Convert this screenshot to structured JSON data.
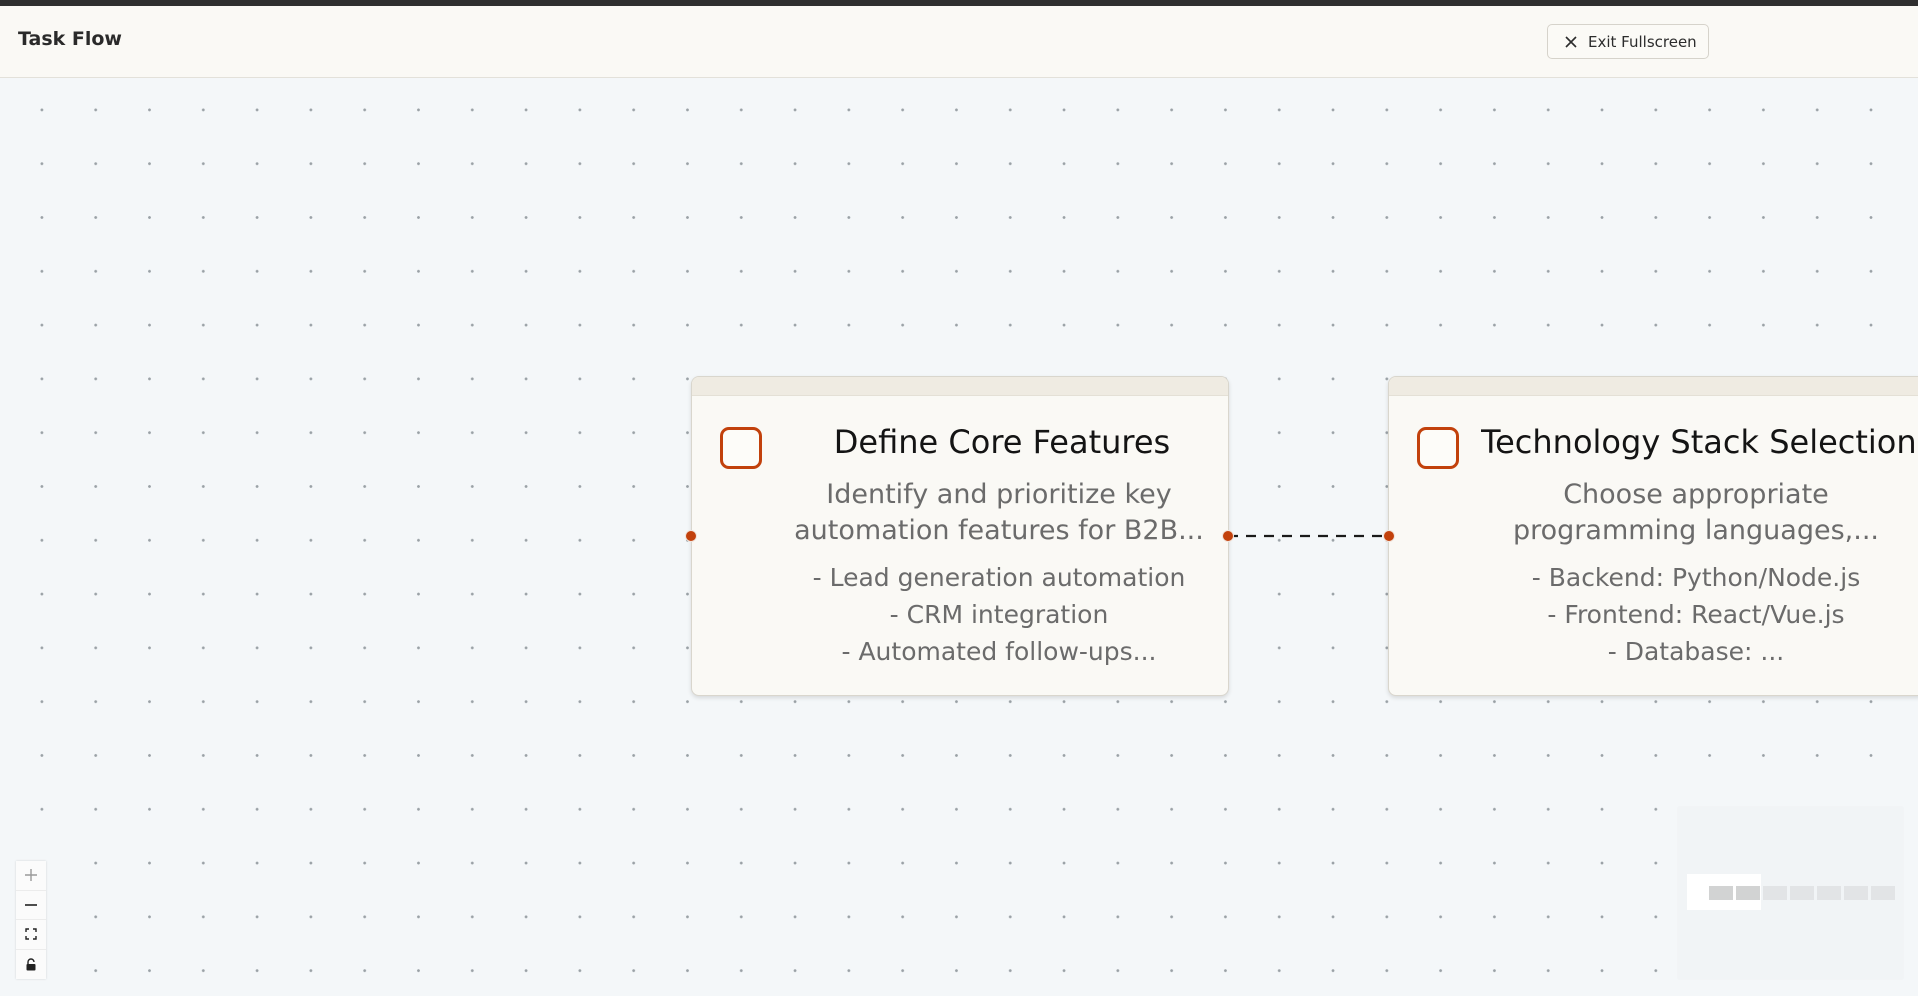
{
  "header": {
    "title": "Task Flow",
    "exit_button_label": "Exit Fullscreen"
  },
  "nodes": [
    {
      "title": "Define Core Features",
      "description_lines": [
        "Identify and prioritize key",
        "automation features for B2B..."
      ],
      "list_items": [
        "- Lead generation automation",
        "- CRM integration",
        "- Automated follow-ups..."
      ],
      "checked": false
    },
    {
      "title": "Technology Stack Selection",
      "description_lines": [
        "Choose appropriate",
        "programming languages,..."
      ],
      "list_items": [
        "- Backend: Python/Node.js",
        "- Frontend: React/Vue.js",
        "- Database: ..."
      ],
      "checked": false
    }
  ],
  "edges": [
    {
      "from": "Define Core Features",
      "to": "Technology Stack Selection",
      "style": "dashed"
    }
  ],
  "controls": [
    "zoom-in",
    "zoom-out",
    "fit-view",
    "lock"
  ],
  "colors": {
    "accent": "#c2410c",
    "canvas_background": "#f4f7f9",
    "node_background": "#faf9f5"
  }
}
